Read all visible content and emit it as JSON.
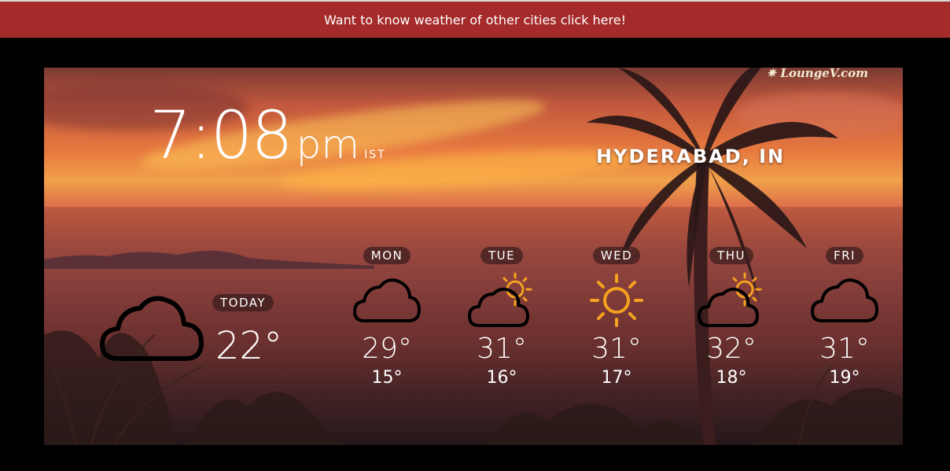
{
  "banner": {
    "text": "Want to know weather of other cities click here!"
  },
  "watermark": "LoungeV.com",
  "clock": {
    "time": "7:08",
    "ampm": "pm",
    "tz": "IST"
  },
  "city": "HYDERABAD, IN",
  "today": {
    "label": "TODAY",
    "temp": "22°",
    "icon": "cloud-icon"
  },
  "forecast": [
    {
      "day": "MON",
      "hi": "29°",
      "lo": "15°",
      "icon": "cloud-icon"
    },
    {
      "day": "TUE",
      "hi": "31°",
      "lo": "16°",
      "icon": "partly-sunny-icon"
    },
    {
      "day": "WED",
      "hi": "31°",
      "lo": "17°",
      "icon": "sun-icon"
    },
    {
      "day": "THU",
      "hi": "32°",
      "lo": "18°",
      "icon": "partly-sunny-icon"
    },
    {
      "day": "FRI",
      "hi": "31°",
      "lo": "19°",
      "icon": "cloud-icon"
    }
  ],
  "colors": {
    "banner": "#a52a2a",
    "sun": "#f4a21f"
  }
}
